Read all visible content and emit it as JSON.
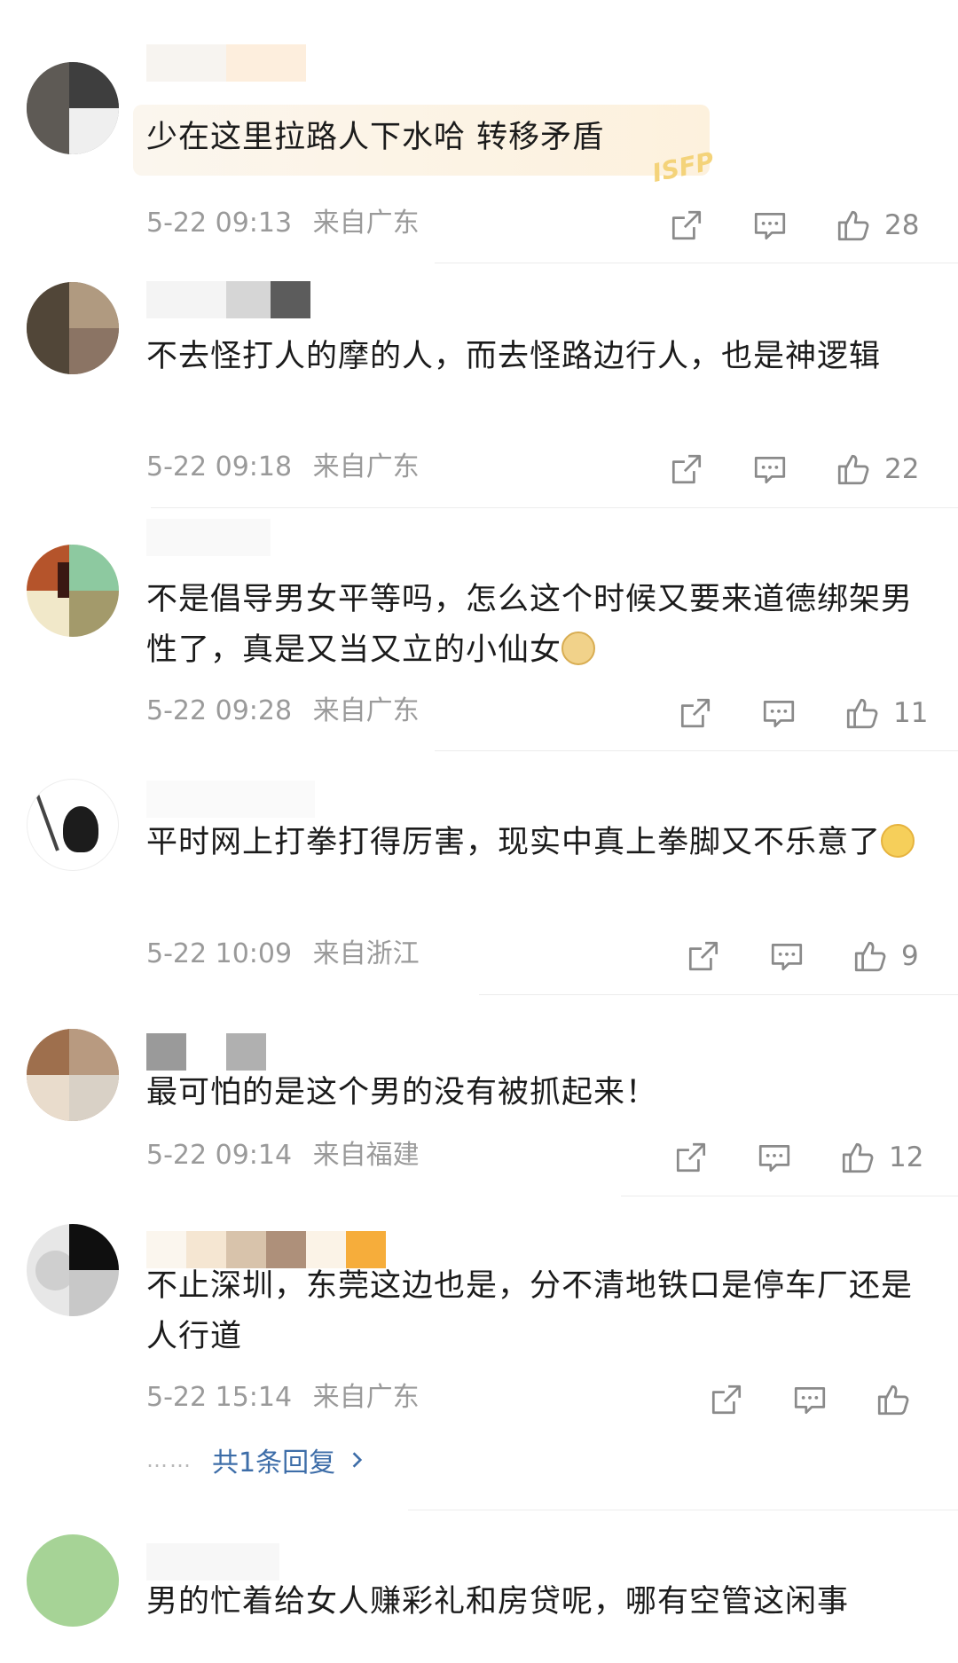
{
  "comments": [
    {
      "text": "少在这里拉路人下水哈 转移矛盾",
      "time": "5-22 09:13",
      "location": "来自广东",
      "likes": "28",
      "badge": "ISFP"
    },
    {
      "text": "不去怪打人的摩的人，而去怪路边行人，也是神逻辑",
      "time": "5-22 09:18",
      "location": "来自广东",
      "likes": "22"
    },
    {
      "text": "不是倡导男女平等吗，怎么这个时候又要来道德绑架男性了，真是又当又立的小仙女",
      "time": "5-22 09:28",
      "location": "来自广东",
      "likes": "11",
      "emoji": "doge-emoji"
    },
    {
      "text": "平时网上打拳打得厉害，现实中真上拳脚又不乐意了",
      "time": "5-22 10:09",
      "location": "来自浙江",
      "likes": "9",
      "emoji": "thinking-emoji"
    },
    {
      "text": "最可怕的是这个男的没有被抓起来！",
      "time": "5-22 09:14",
      "location": "来自福建",
      "likes": "12"
    },
    {
      "text": "不止深圳，东莞这边也是，分不清地铁口是停车厂还是人行道",
      "time": "5-22 15:14",
      "location": "来自广东",
      "likes": "",
      "replies": "共1条回复"
    },
    {
      "text": "男的忙着给女人赚彩礼和房贷呢，哪有空管这闲事"
    }
  ],
  "icons": {
    "share": "share-icon",
    "comment": "comment-icon",
    "like": "thumbs-up-icon",
    "chevron": "chevron-right-icon"
  },
  "colors": {
    "link": "#3d6da8",
    "meta": "#9a9a9a",
    "icon": "#8a8a8a"
  }
}
